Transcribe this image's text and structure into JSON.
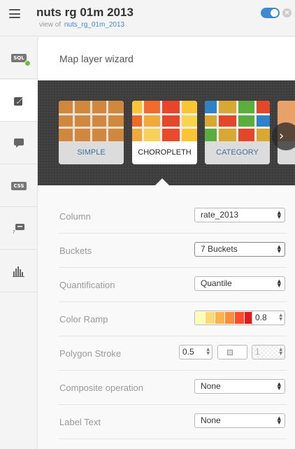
{
  "header": {
    "title": "nuts rg 01m 2013",
    "view_of_prefix": "view of",
    "view_of_link": "nuts_rg_01m_2013"
  },
  "rail": {
    "sql_icon_text": "SQL",
    "css_icon_text": "CSS",
    "items": [
      "sql-icon",
      "wizard-brush-icon",
      "infowindow-comment-icon",
      "css-icon",
      "legend-icon",
      "histogram-icon"
    ]
  },
  "panel": {
    "title": "Map layer wizard"
  },
  "wizard_types": [
    {
      "label": "SIMPLE"
    },
    {
      "label": "CHOROPLETH"
    },
    {
      "label": "CATEGORY"
    }
  ],
  "colors": {
    "accent": "#3f8acd",
    "simple_tile": "#d0873e",
    "choropleth_tiles": [
      "#f9c533",
      "#f26b2c",
      "#e8452b",
      "#f9c533",
      "#f06a24",
      "#f2a93a",
      "#e4472b",
      "#f9d54e",
      "#f2a93a",
      "#f8d05a",
      "#e84a2c",
      "#f9c533"
    ],
    "category_tiles": [
      "#2e82c6",
      "#d8a932",
      "#5aae3e",
      "#e2472c",
      "#d8a932",
      "#e2472c",
      "#5aae3e",
      "#2e82c6",
      "#d8a932",
      "#e2472c"
    ],
    "color_ramp": [
      "#ffffb2",
      "#fed976",
      "#feb24c",
      "#fd8d3c",
      "#fc4e2a",
      "#e31a1c",
      "#b10026"
    ]
  },
  "form": {
    "column": {
      "label": "Column",
      "value": "rate_2013"
    },
    "buckets": {
      "label": "Buckets",
      "value": "7 Buckets"
    },
    "quantification": {
      "label": "Quantification",
      "value": "Quantile"
    },
    "color_ramp": {
      "label": "Color Ramp",
      "opacity": "0.8"
    },
    "polygon_stroke": {
      "label": "Polygon Stroke",
      "width": "0.5",
      "opacity": "1"
    },
    "composite": {
      "label": "Composite operation",
      "value": "None"
    },
    "label_text": {
      "label": "Label Text",
      "value": "None"
    }
  }
}
